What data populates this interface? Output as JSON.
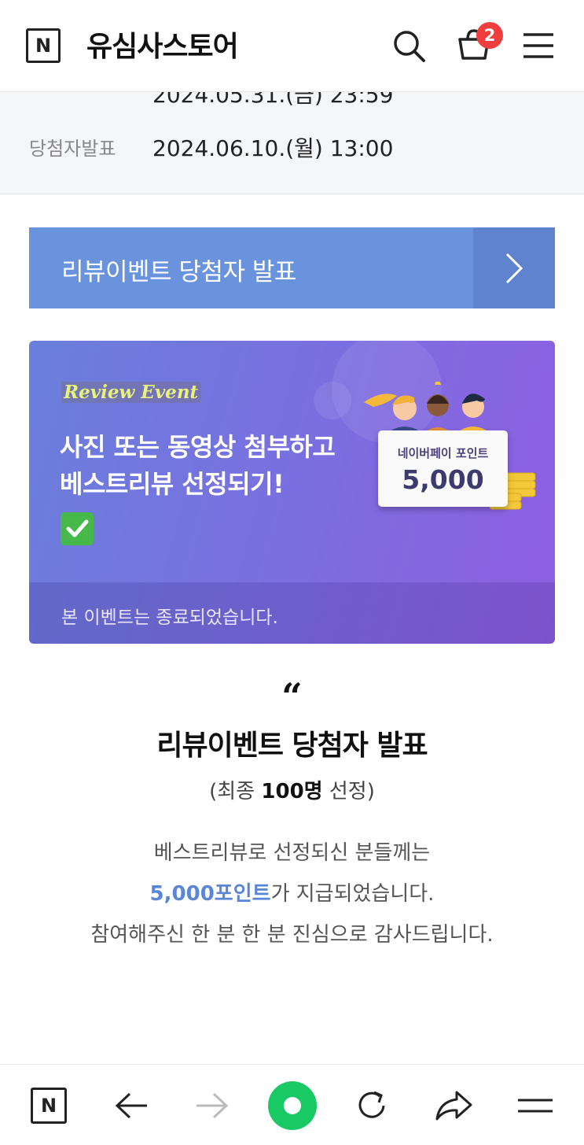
{
  "header": {
    "logo_letter": "N",
    "store_name": "유심사스토어",
    "cart_count": "2"
  },
  "info": {
    "cut_off_line": "2024.05.31.(금) 23:59",
    "announce_label": "당첨자발표",
    "announce_value": "2024.06.10.(월) 13:00"
  },
  "winner_button": {
    "label": "리뷰이벤트 당첨자 발표"
  },
  "event_banner": {
    "tag": "Review Event",
    "headline": "사진 또는 동영상 첨부하고 베스트리뷰 선정되기!",
    "point_card_label": "네이버페이 포인트",
    "point_card_value": "5,000",
    "ended_notice": "본 이벤트는 종료되었습니다."
  },
  "announcement": {
    "quote": "“",
    "title": "리뷰이벤트 당첨자 발표",
    "sub_prefix": "(최종 ",
    "sub_bold": "100명",
    "sub_suffix": " 선정)",
    "line1": "베스트리뷰로 선정되신 분들께는",
    "line2_highlight": "5,000포인트",
    "line2_rest": "가 지급되었습니다.",
    "line3": "참여해주신 한 분 한 분 진심으로 감사드립니다."
  },
  "bottom_nav": {
    "logo_letter": "N"
  },
  "colors": {
    "accent_blue": "#6a93dd",
    "highlight_blue": "#5b86d6",
    "badge_red": "#f03d3d",
    "home_green": "#18c964",
    "banner_purple": "#8f5ee1"
  },
  "icons": [
    "naver-n-icon",
    "search-icon",
    "cart-icon",
    "menu-icon",
    "chevron-right-icon",
    "check-icon",
    "back-arrow-icon",
    "forward-arrow-icon",
    "home-icon",
    "refresh-icon",
    "share-icon",
    "menu-icon"
  ]
}
